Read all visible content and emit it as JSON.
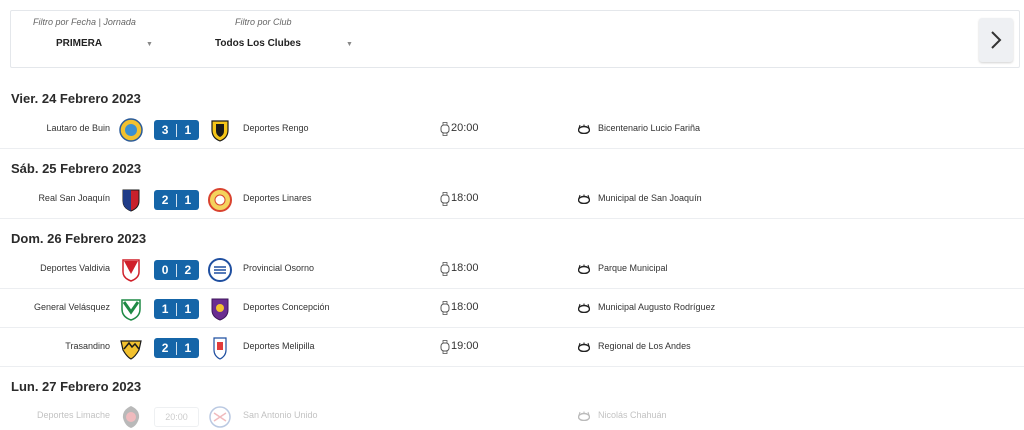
{
  "filters": {
    "date": {
      "label": "Filtro por Fecha | Jornada",
      "value": "PRIMERA"
    },
    "club": {
      "label": "Filtro por Club",
      "value": "Todos Los Clubes"
    }
  },
  "colors": {
    "score_bg": "#1565a8",
    "divider": "#eceef1",
    "text": "#333333"
  },
  "days": [
    {
      "title": "Vier. 24 Febrero 2023",
      "matches": [
        {
          "home": "Lautaro de Buin",
          "home_icon": "lautaro-de-buin-crest-icon",
          "score_home": "3",
          "score_away": "1",
          "away": "Deportes Rengo",
          "away_icon": "deportes-rengo-crest-icon",
          "time": "20:00",
          "stadium": "Bicentenario Lucio Fariña"
        }
      ]
    },
    {
      "title": "Sáb. 25 Febrero 2023",
      "matches": [
        {
          "home": "Real San Joaquín",
          "home_icon": "real-san-joaquin-crest-icon",
          "score_home": "2",
          "score_away": "1",
          "away": "Deportes Linares",
          "away_icon": "deportes-linares-crest-icon",
          "time": "18:00",
          "stadium": "Municipal de San Joaquín"
        }
      ]
    },
    {
      "title": "Dom. 26 Febrero 2023",
      "matches": [
        {
          "home": "Deportes Valdivia",
          "home_icon": "deportes-valdivia-crest-icon",
          "score_home": "0",
          "score_away": "2",
          "away": "Provincial Osorno",
          "away_icon": "provincial-osorno-crest-icon",
          "time": "18:00",
          "stadium": "Parque Municipal"
        },
        {
          "home": "General Velásquez",
          "home_icon": "general-velasquez-crest-icon",
          "score_home": "1",
          "score_away": "1",
          "away": "Deportes Concepción",
          "away_icon": "deportes-concepcion-crest-icon",
          "time": "18:00",
          "stadium": "Municipal Augusto Rodríguez"
        },
        {
          "home": "Trasandino",
          "home_icon": "trasandino-crest-icon",
          "score_home": "2",
          "score_away": "1",
          "away": "Deportes Melipilla",
          "away_icon": "deportes-melipilla-crest-icon",
          "time": "19:00",
          "stadium": "Regional de Los Andes"
        }
      ]
    },
    {
      "title": "Lun. 27 Febrero 2023",
      "matches": [
        {
          "home": "Deportes Limache",
          "home_icon": "deportes-limache-crest-icon",
          "time_box": "20:00",
          "away": "San Antonio Unido",
          "away_icon": "san-antonio-unido-crest-icon",
          "stadium": "Nicolás Chahuán"
        }
      ]
    }
  ]
}
